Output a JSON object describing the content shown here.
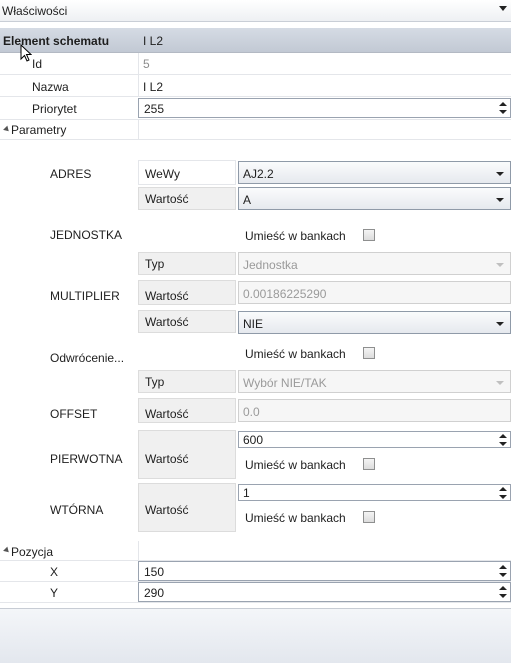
{
  "panel": {
    "title": "Właściwości"
  },
  "element": {
    "label": "Element schematu",
    "value": "I L2"
  },
  "props": {
    "id": {
      "label": "Id",
      "value": "5"
    },
    "name": {
      "label": "Nazwa",
      "value": "I L2"
    },
    "priority": {
      "label": "Priorytet",
      "value": "255"
    }
  },
  "parametry": {
    "label": "Parametry",
    "adres": {
      "label": "ADRES",
      "sub": "WeWy",
      "value": "AJ2.2"
    },
    "jednostka": {
      "label": "JEDNOSTKA",
      "value_label": "Wartość",
      "value": "A",
      "bank_label": "Umieść w bankach",
      "type_label": "Typ",
      "type_value": "Jednostka"
    },
    "multiplier": {
      "label": "MULTIPLIER",
      "value_label": "Wartość",
      "value": "0.00186225290"
    },
    "odwrocenie": {
      "label": "Odwrócenie...",
      "value_label": "Wartość",
      "value": "NIE",
      "bank_label": "Umieść w bankach",
      "type_label": "Typ",
      "type_value": "Wybór NIE/TAK"
    },
    "offset": {
      "label": "OFFSET",
      "value_label": "Wartość",
      "value": "0.0"
    },
    "pierwotna": {
      "label": "PIERWOTNA",
      "value_label": "Wartość",
      "value": "600",
      "bank_label": "Umieść w bankach"
    },
    "wtorna": {
      "label": "WTÓRNA",
      "value_label": "Wartość",
      "value": "1",
      "bank_label": "Umieść w bankach"
    }
  },
  "pozycja": {
    "label": "Pozycja",
    "x": {
      "label": "X",
      "value": "150"
    },
    "y": {
      "label": "Y",
      "value": "290"
    }
  }
}
